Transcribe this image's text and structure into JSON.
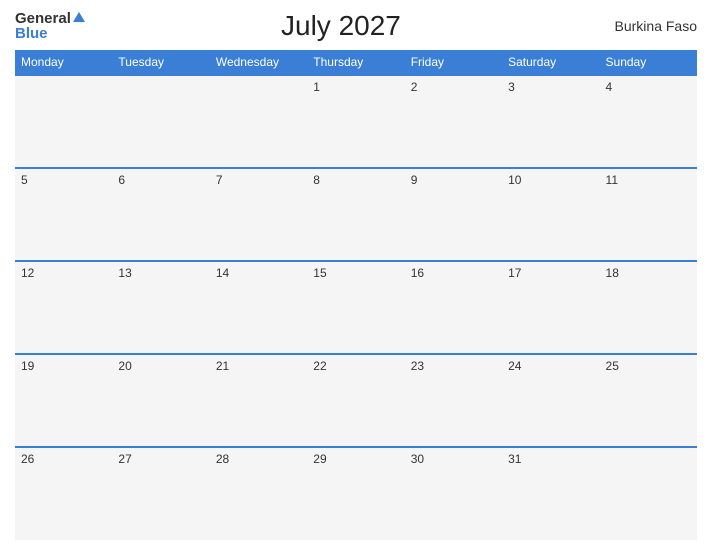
{
  "logo": {
    "general": "General",
    "blue": "Blue"
  },
  "title": "July 2027",
  "country": "Burkina Faso",
  "days_header": [
    "Monday",
    "Tuesday",
    "Wednesday",
    "Thursday",
    "Friday",
    "Saturday",
    "Sunday"
  ],
  "weeks": [
    [
      "",
      "",
      "",
      "1",
      "2",
      "3",
      "4"
    ],
    [
      "5",
      "6",
      "7",
      "8",
      "9",
      "10",
      "11"
    ],
    [
      "12",
      "13",
      "14",
      "15",
      "16",
      "17",
      "18"
    ],
    [
      "19",
      "20",
      "21",
      "22",
      "23",
      "24",
      "25"
    ],
    [
      "26",
      "27",
      "28",
      "29",
      "30",
      "31",
      ""
    ]
  ]
}
